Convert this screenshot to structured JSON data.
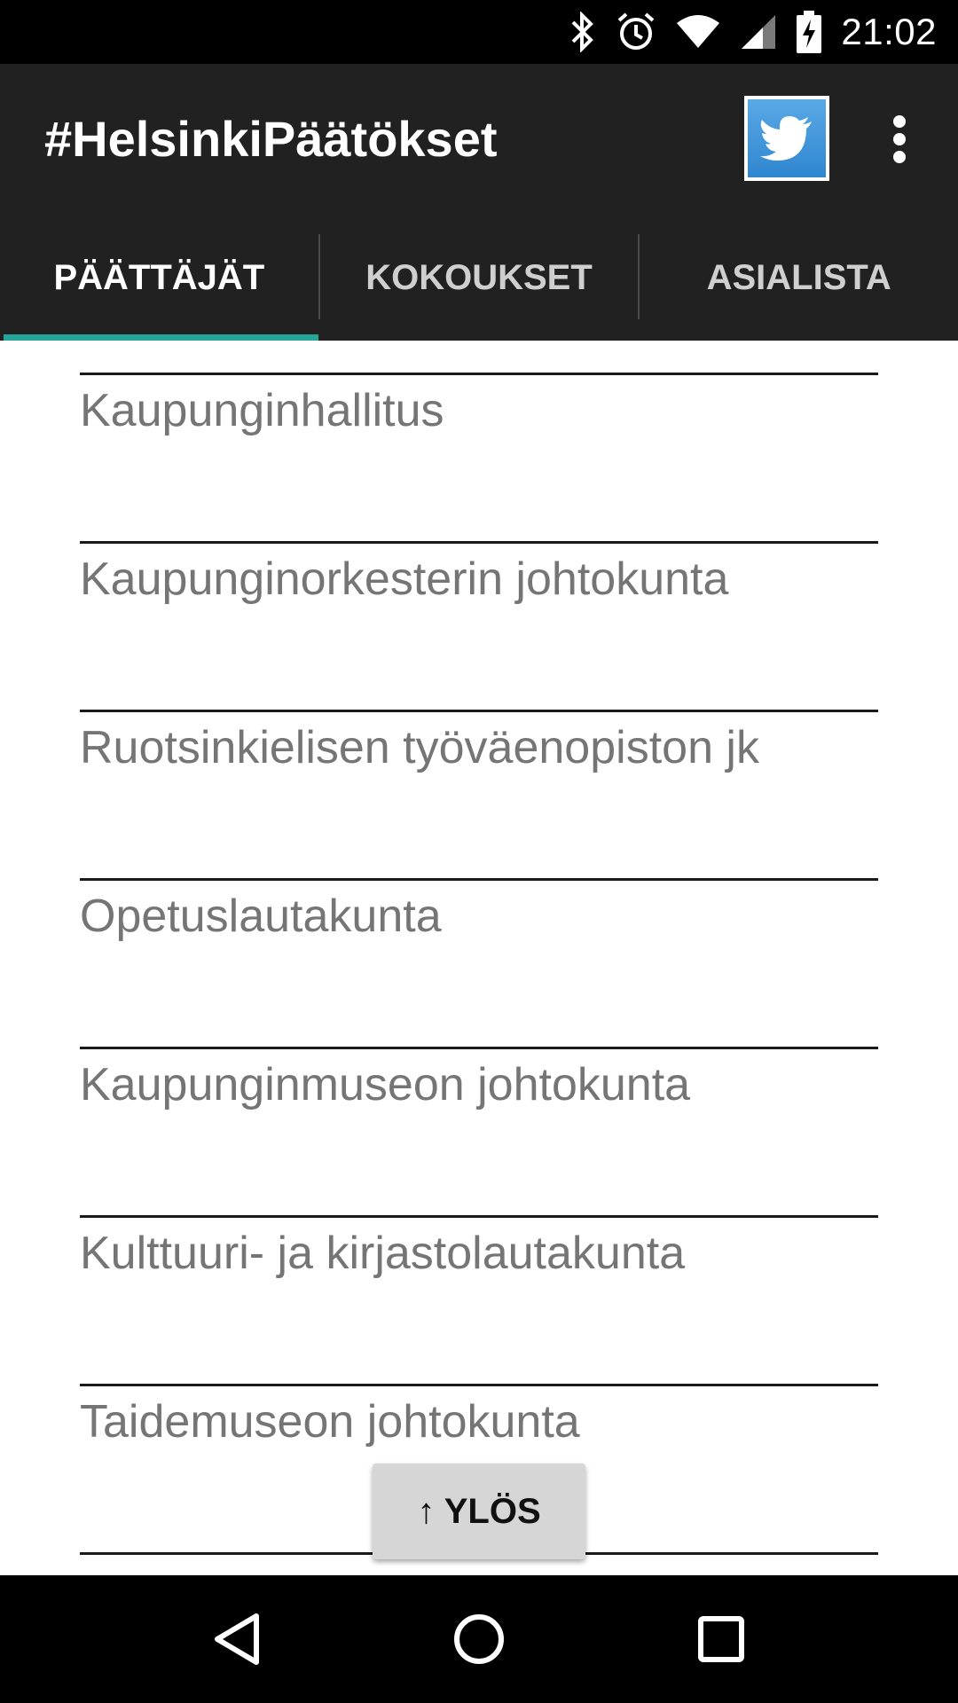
{
  "status_bar": {
    "time": "21:02",
    "icons": [
      "bluetooth-icon",
      "alarm-icon",
      "wifi-icon",
      "cell-signal-icon",
      "battery-charging-icon"
    ]
  },
  "action_bar": {
    "title": "#HelsinkiPäätökset",
    "twitter_icon": "twitter-icon",
    "overflow_icon": "more-vert-icon"
  },
  "tabs": [
    {
      "label": "PÄÄTTÄJÄT",
      "active": true
    },
    {
      "label": "KOKOUKSET",
      "active": false
    },
    {
      "label": "ASIALISTA",
      "active": false
    }
  ],
  "colors": {
    "toolbar": "#212121",
    "tab_indicator": "#26a69a",
    "list_text": "#757575"
  },
  "list": {
    "items": [
      "Kaupunginhallitus",
      "Kaupunginorkesterin johtokunta",
      "Ruotsinkielisen työväenopiston jk",
      "Opetuslautakunta",
      "Kaupunginmuseon johtokunta",
      "Kulttuuri- ja kirjastolautakunta",
      "Taidemuseon johtokunta"
    ]
  },
  "up_button": {
    "label": "↑ YLÖS"
  },
  "nav_bar": {
    "icons": [
      "back-icon",
      "home-icon",
      "recents-icon"
    ]
  }
}
